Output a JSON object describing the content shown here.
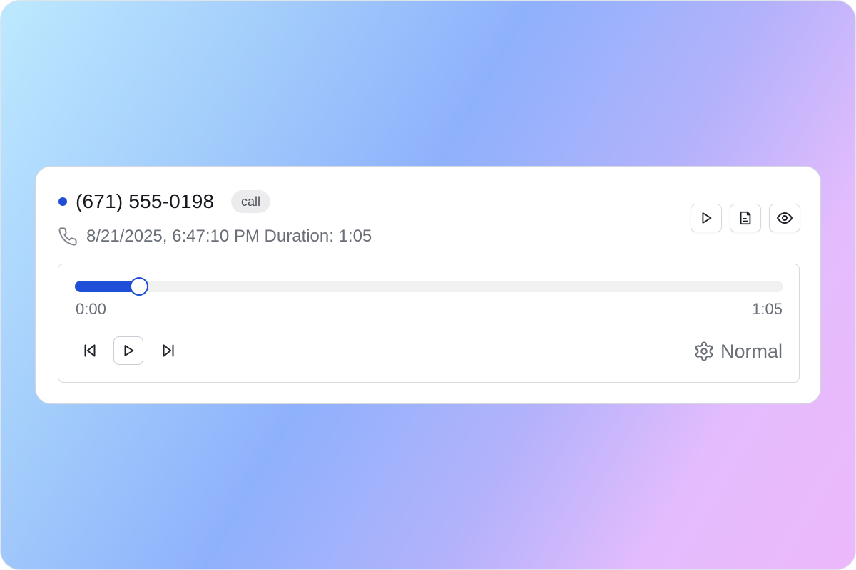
{
  "recording": {
    "title": "(671) 555-0198",
    "type_badge": "call",
    "meta": "8/21/2025, 6:47:10 PM Duration: 1:05"
  },
  "actions": [
    {
      "name": "play",
      "icon": "play-icon"
    },
    {
      "name": "transcript",
      "icon": "transcript-icon"
    },
    {
      "name": "view",
      "icon": "eye-icon"
    }
  ],
  "player": {
    "current_time": "0:00",
    "total_time": "1:05",
    "progress_fraction": 0.09,
    "speed_label": "Normal",
    "controls": [
      "skip-back-icon",
      "play-icon",
      "skip-forward-icon",
      "gear-icon"
    ]
  },
  "colors": {
    "accent": "#1f4fd6",
    "badge_bg": "#ececee",
    "muted_text": "#6a6f78"
  }
}
